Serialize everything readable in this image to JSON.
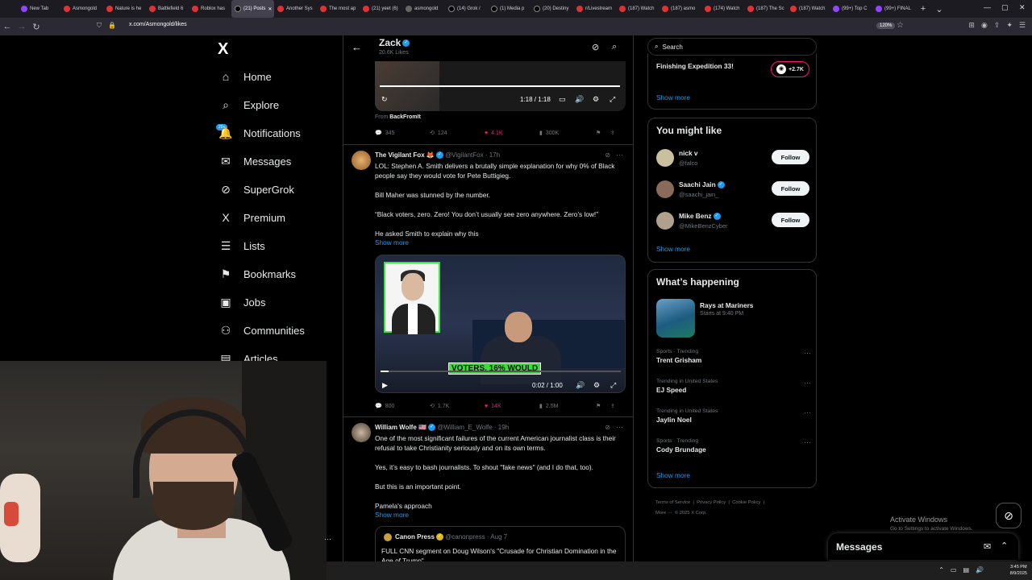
{
  "browser": {
    "tabs": [
      {
        "label": "New Tab",
        "icon": "p",
        "active": false
      },
      {
        "label": "Asmongold",
        "icon": "r",
        "active": false
      },
      {
        "label": "Nature is he",
        "icon": "r",
        "active": false
      },
      {
        "label": "Battlefield 6",
        "icon": "r",
        "active": false
      },
      {
        "label": "Roblox has",
        "icon": "r",
        "active": false
      },
      {
        "label": "(21) Posts",
        "icon": "x",
        "active": true
      },
      {
        "label": "Another Sys",
        "icon": "r",
        "active": false
      },
      {
        "label": "The most ap",
        "icon": "r",
        "active": false
      },
      {
        "label": "(21) yeet (6)",
        "icon": "r",
        "active": false
      },
      {
        "label": "asmongold",
        "icon": "g",
        "active": false
      },
      {
        "label": "(14) Grok /",
        "icon": "x",
        "active": false
      },
      {
        "label": "(1) Media p",
        "icon": "x",
        "active": false
      },
      {
        "label": "(20) Destiny",
        "icon": "x",
        "active": false
      },
      {
        "label": "r/Livestream",
        "icon": "r",
        "active": false
      },
      {
        "label": "(187) Watch",
        "icon": "r",
        "active": false
      },
      {
        "label": "(187) asmo",
        "icon": "r",
        "active": false
      },
      {
        "label": "(174) Watch",
        "icon": "r",
        "active": false
      },
      {
        "label": "(187) The Sc",
        "icon": "r",
        "active": false
      },
      {
        "label": "(187) Watch",
        "icon": "r",
        "active": false
      },
      {
        "label": "(99+) Top C",
        "icon": "p",
        "active": false
      },
      {
        "label": "(99+) FINAL",
        "icon": "p",
        "active": false
      }
    ],
    "url": "x.com/Asmongold/likes",
    "zoom": "120%"
  },
  "nav": {
    "logo": "X",
    "notif_badge": "20+",
    "items": [
      {
        "label": "Home",
        "icon": "⌂"
      },
      {
        "label": "Explore",
        "icon": "⌕"
      },
      {
        "label": "Notifications",
        "icon": "🔔"
      },
      {
        "label": "Messages",
        "icon": "✉"
      },
      {
        "label": "SuperGrok",
        "icon": "⊘"
      },
      {
        "label": "Premium",
        "icon": "X"
      },
      {
        "label": "Lists",
        "icon": "☰"
      },
      {
        "label": "Bookmarks",
        "icon": "⚑"
      },
      {
        "label": "Jobs",
        "icon": "▣"
      },
      {
        "label": "Communities",
        "icon": "⚇"
      },
      {
        "label": "Articles",
        "icon": "▤"
      }
    ]
  },
  "header": {
    "name": "Zack",
    "sub": "20.6K Likes"
  },
  "tweet0": {
    "time": "1:18 / 1:18",
    "from_label": "From",
    "from_name": "BackFromIt",
    "replies": "345",
    "reposts": "124",
    "likes": "4.1K",
    "views": "300K"
  },
  "tweet1": {
    "name": "The Vigilant Fox 🦊",
    "handle": "@VigilantFox · 17h",
    "line1": "LOL: Stephen A. Smith delivers a brutally simple explanation for why 0% of Black people say they would vote for Pete Buttigieg.",
    "line2": "Bill Maher was stunned by the number.",
    "line3": "“Black voters, zero. Zero! You don’t usually see zero anywhere. Zero’s low!”",
    "line4": "He asked Smith to explain why this",
    "show_more": "Show more",
    "caption": "VOTERS, 16% WOULD",
    "time": "0:02 / 1:00",
    "replies": "800",
    "reposts": "1.7K",
    "likes": "14K",
    "views": "2.5M"
  },
  "tweet2": {
    "name": "William Wolfe 🇺🇸",
    "handle": "@William_E_Wolfe · 19h",
    "line1": "One of the most significant failures of the current American journalist class is their refusal to take Christianity seriously and on its own terms.",
    "line2": "Yes, it’s easy to bash journalists. To shout \"fake news\" (and I do that, too).",
    "line3": "But this is an important point.",
    "line4": "Pamela's approach",
    "show_more": "Show more",
    "quote_name": "Canon Press",
    "quote_handle": "@canonpress · Aug 7",
    "quote_text": "FULL CNN segment on Doug Wilson's \"Crusade for Christian Domination in the Age of Trump\""
  },
  "right": {
    "search_placeholder": "Search",
    "top_trend": "Finishing Expedition 33!",
    "top_count": "+2.7K",
    "show_more": "Show more",
    "might_like_title": "You might like",
    "people": [
      {
        "name": "nick v",
        "handle": "@falco",
        "verified": false,
        "follow": "Follow"
      },
      {
        "name": "Saachi Jain",
        "handle": "@saachi_jain_",
        "verified": true,
        "follow": "Follow"
      },
      {
        "name": "Mike Benz",
        "handle": "@MikeBenzCyber",
        "verified": true,
        "follow": "Follow"
      }
    ],
    "happening_title": "What’s happening",
    "event_name": "Rays at Mariners",
    "event_time": "Starts at 9:40 PM",
    "trends": [
      {
        "ctx": "Sports · Trending",
        "title": "Trent Grisham"
      },
      {
        "ctx": "Trending in United States",
        "title": "EJ Speed"
      },
      {
        "ctx": "Trending in United States",
        "title": "Jaylin Noel"
      },
      {
        "ctx": "Sports · Trending",
        "title": "Cody Brundage"
      }
    ],
    "footer": {
      "terms": "Terms of Service",
      "privacy": "Privacy Policy",
      "cookie": "Cookie Policy",
      "more": "More ···",
      "copy": "© 2025 X Corp."
    }
  },
  "windows": {
    "activate1": "Activate Windows",
    "activate2": "Go to Settings to activate Windows.",
    "time": "3:45 PM",
    "date": "8/9/2025"
  },
  "messages": {
    "title": "Messages"
  }
}
